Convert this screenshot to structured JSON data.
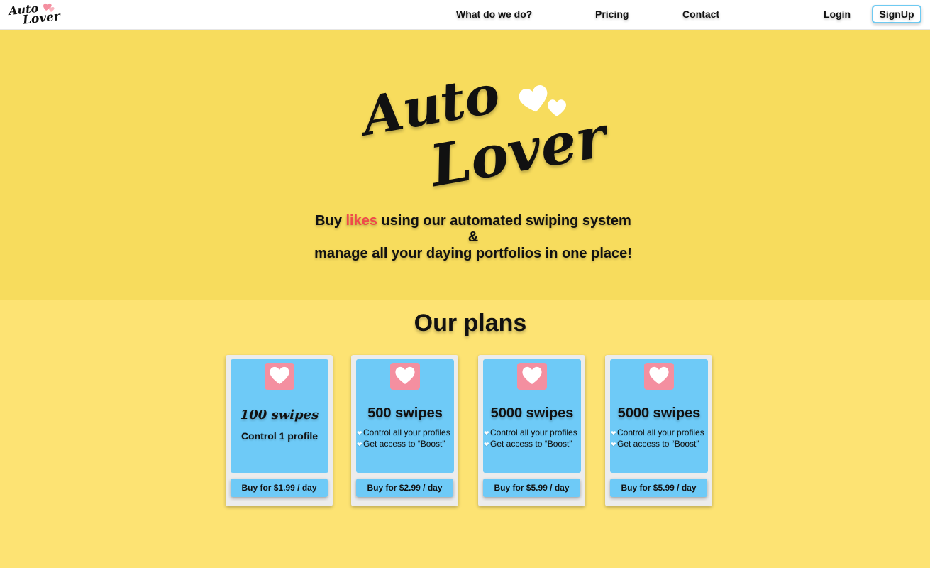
{
  "nav": {
    "logo_line1": "Auto",
    "logo_line2": "Lover",
    "links": [
      "What do we do?",
      "Pricing",
      "Contact"
    ],
    "login": "Login",
    "signup": "SignUp"
  },
  "hero": {
    "logo_line1": "Auto",
    "logo_line2": "Lover",
    "tagline_pre": "Buy ",
    "tagline_accent": "likes",
    "tagline_post": " using our automated swiping system",
    "tagline_amp": "&",
    "tagline_line3": "manage all your daying portfolios in one place!"
  },
  "plans": {
    "title": "Our plans",
    "cards": [
      {
        "title": "100 swipes",
        "desc": "Control 1 profile",
        "button": "Buy for $1.99 / day"
      },
      {
        "title": "500 swipes",
        "features": [
          "Control all your profiles",
          "Get access to “Boost”"
        ],
        "button": "Buy for $2.99 / day"
      },
      {
        "title": "5000 swipes",
        "features": [
          "Control all your profiles",
          "Get access to “Boost”"
        ],
        "button": "Buy for $5.99 / day"
      },
      {
        "title": "5000 swipes",
        "features": [
          "Control all your profiles",
          "Get access to “Boost”"
        ],
        "button": "Buy for $5.99 / day"
      }
    ]
  },
  "colors": {
    "hero_bg": "#f7dc5d",
    "page_bg": "#fde373",
    "card_blue": "#6ecaf7",
    "heart_pink": "#f48fa0",
    "accent_red": "#f04a4a"
  },
  "icons": {
    "logo_hearts": "hearts-icon",
    "card_icon": "heart-icon",
    "feature_bullet": "heart-bullet-icon"
  }
}
